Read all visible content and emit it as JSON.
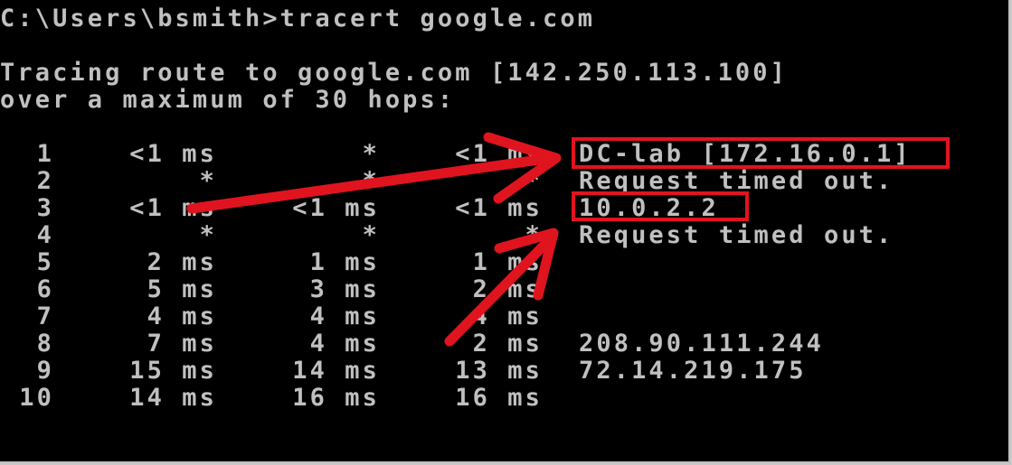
{
  "console": {
    "command_line": "C:\\Users\\bsmith>tracert google.com",
    "trace_line": "Tracing route to google.com [142.250.113.100]",
    "hops_line": "over a maximum of 30 hops:"
  },
  "hops": [
    {
      "hop": "1",
      "t1": "<1 ms",
      "t2": "*",
      "t3": "<1 ms",
      "host": "DC-lab [172.16.0.1]"
    },
    {
      "hop": "2",
      "t1": "*",
      "t2": "*",
      "t3": "*",
      "host": "Request timed out."
    },
    {
      "hop": "3",
      "t1": "<1 ms",
      "t2": "<1 ms",
      "t3": "<1 ms",
      "host": "10.0.2.2"
    },
    {
      "hop": "4",
      "t1": "*",
      "t2": "*",
      "t3": "*",
      "host": "Request timed out."
    },
    {
      "hop": "5",
      "t1": "2 ms",
      "t2": "1 ms",
      "t3": "1 ms",
      "host": ""
    },
    {
      "hop": "6",
      "t1": "5 ms",
      "t2": "3 ms",
      "t3": "2 ms",
      "host": ""
    },
    {
      "hop": "7",
      "t1": "4 ms",
      "t2": "4 ms",
      "t3": "4 ms",
      "host": ""
    },
    {
      "hop": "8",
      "t1": "7 ms",
      "t2": "4 ms",
      "t3": "2 ms",
      "host": "208.90.111.244"
    },
    {
      "hop": "9",
      "t1": "15 ms",
      "t2": "14 ms",
      "t3": "13 ms",
      "host": "72.14.219.175"
    },
    {
      "hop": "10",
      "t1": "14 ms",
      "t2": "16 ms",
      "t3": "16 ms",
      "host": ""
    }
  ],
  "annotation_color": "#e0141e",
  "text_color": "#c0c0c0",
  "background_color": "#000000"
}
